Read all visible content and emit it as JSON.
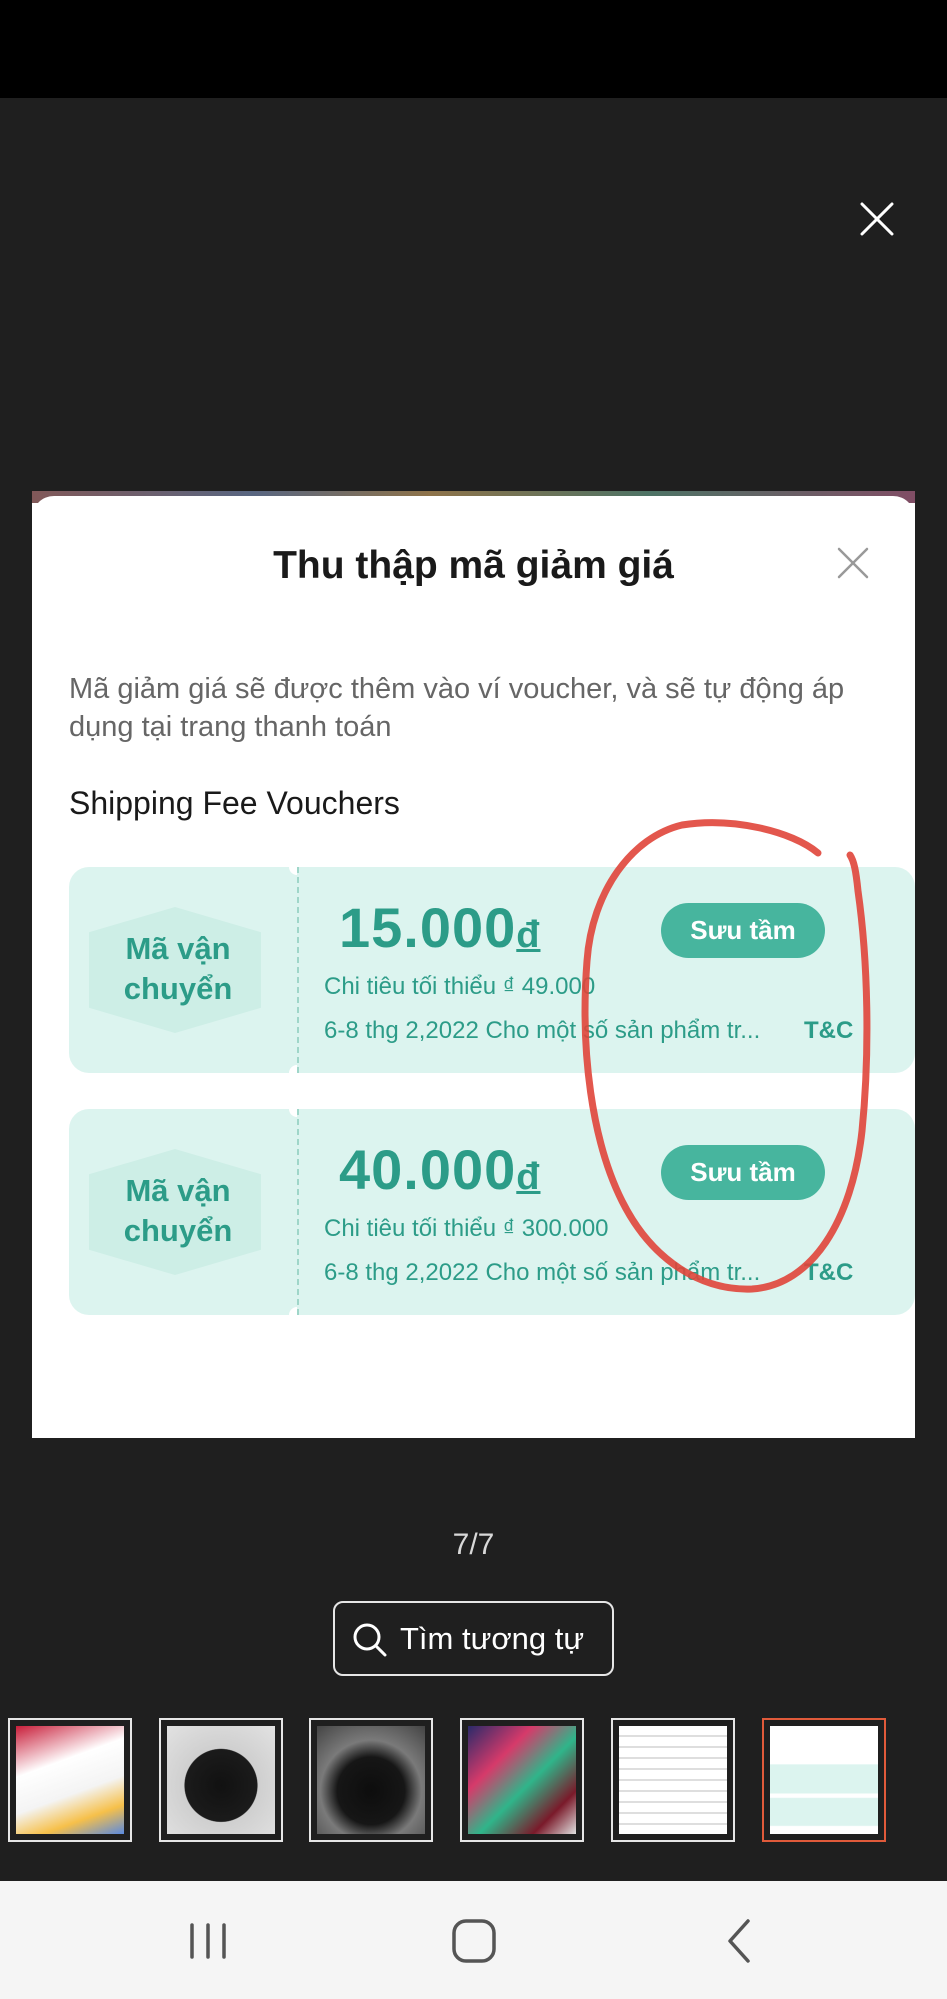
{
  "viewer": {
    "page_counter": "7/7",
    "search_button_label": "Tìm tương tự"
  },
  "sheet": {
    "title": "Thu thập mã giảm giá",
    "description": "Mã giảm giá sẽ được thêm vào ví voucher, và sẽ tự động áp dụng tại trang thanh toán",
    "section_title": "Shipping Fee Vouchers"
  },
  "vouchers": [
    {
      "type_line1": "Mã vận",
      "type_line2": "chuyển",
      "amount": "15.000",
      "currency": "đ",
      "min_spend": "Chi tiêu tối thiểu ₫ 49.000",
      "validity": "6-8 thg 2,2022 Cho một số sản phẩm tr...",
      "tnc": "T&C",
      "button": "Sưu tầm"
    },
    {
      "type_line1": "Mã vận",
      "type_line2": "chuyển",
      "amount": "40.000",
      "currency": "đ",
      "min_spend": "Chi tiêu tối thiểu ₫ 300.000",
      "validity": "6-8 thg 2,2022 Cho một số sản phẩm tr...",
      "tnc": "T&C",
      "button": "Sưu tầm"
    }
  ],
  "colors": {
    "accent": "#2c9c88",
    "button": "#47b59e",
    "voucher_bg": "#dcf4ef",
    "annotation": "#e0453a",
    "active_thumb_border": "#e05a3a"
  },
  "icons": {
    "viewer_close": "close-icon",
    "sheet_close": "close-icon",
    "search": "search-icon",
    "nav_recents": "recents-icon",
    "nav_home": "home-icon",
    "nav_back": "back-icon"
  },
  "thumbnails": {
    "count": 6,
    "active_index": 5
  }
}
